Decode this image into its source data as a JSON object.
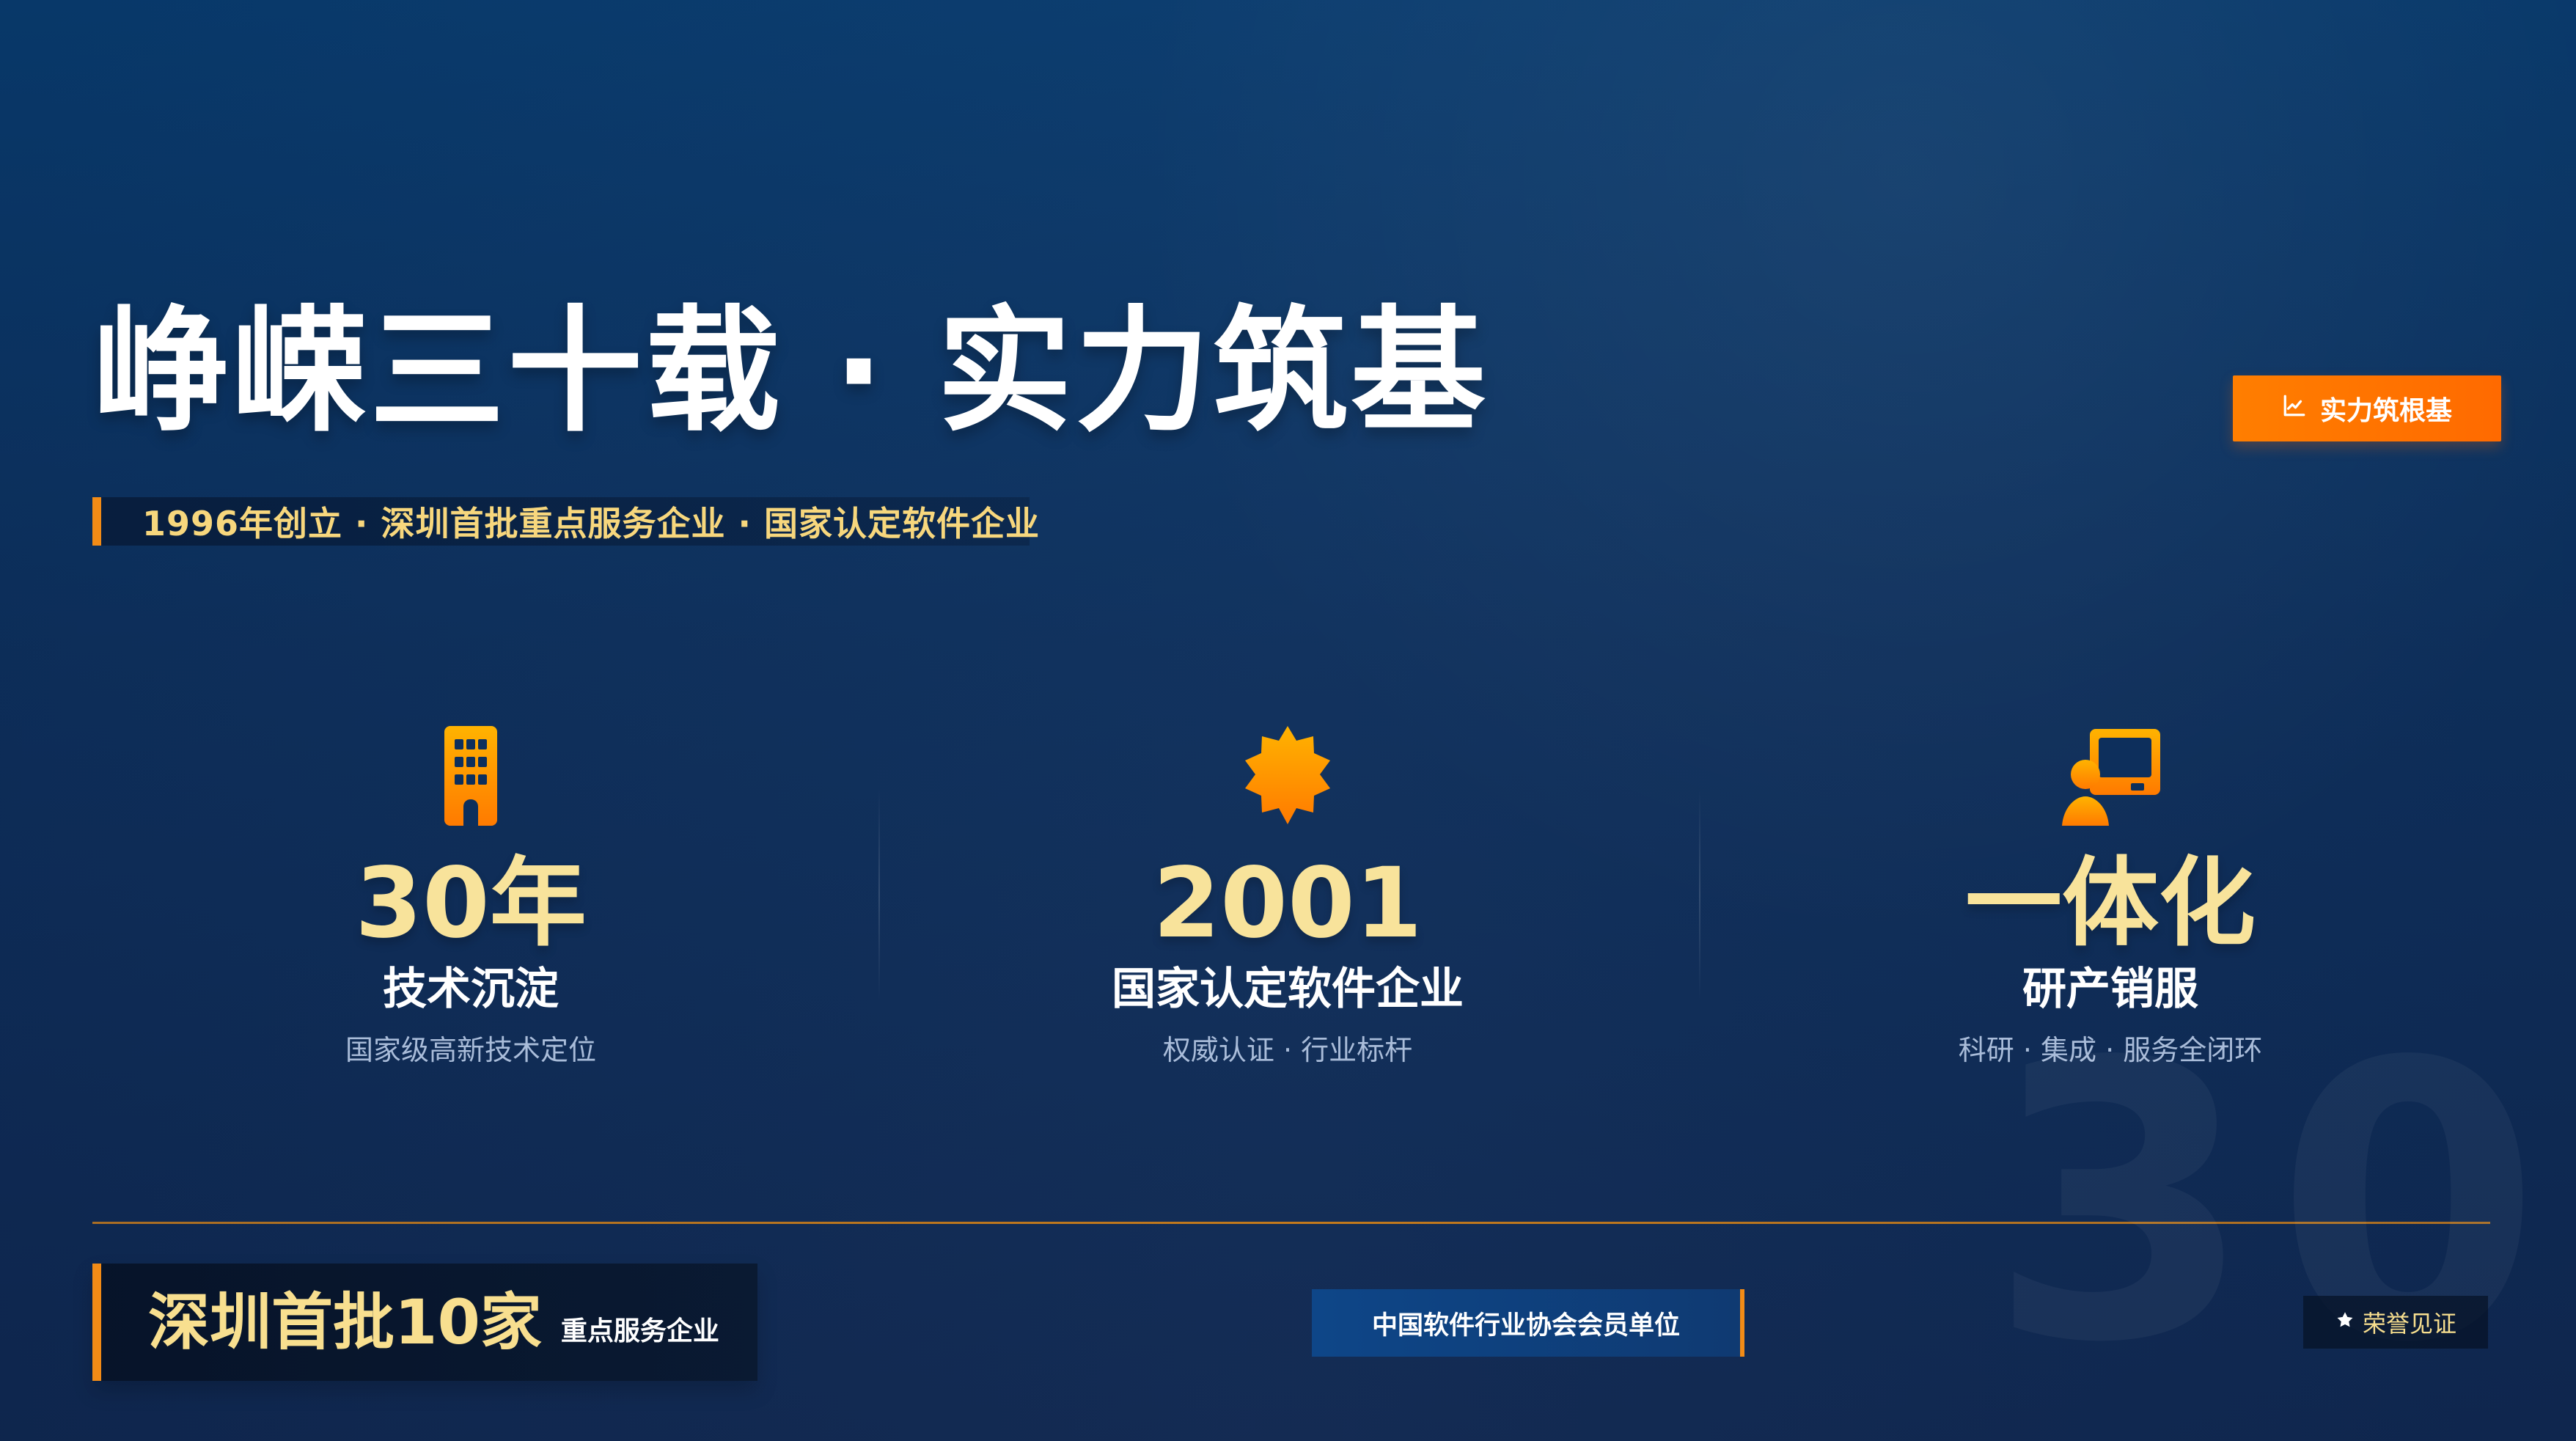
{
  "title": "峥嵘三十载 · 实力筑基",
  "subtitle": "1996年创立 · 深圳首批重点服务企业 · 国家认定软件企业",
  "top_badge": {
    "label": "实力筑根基",
    "icon": "chart-line-icon",
    "color": "#ff7200"
  },
  "stats": [
    {
      "icon": "building-icon",
      "value": "30年",
      "label": "技术沉淀",
      "desc": "国家级高新技术定位"
    },
    {
      "icon": "badge-star-icon",
      "value": "2001",
      "label": "国家认定软件企业",
      "desc": "权威认证 · 行业标杆"
    },
    {
      "icon": "presenter-icon",
      "value": "一体化",
      "label": "研产销服",
      "desc": "科研 · 集成 · 服务全闭环"
    }
  ],
  "bottom": {
    "left_main": "深圳首批10家",
    "left_sub": "重点服务企业",
    "member": "中国软件行业协会会员单位",
    "honor": {
      "label": "荣誉见证",
      "icon": "star-icon"
    },
    "watermark": "30"
  },
  "colors": {
    "background_top": "#083a6d",
    "background_bottom": "#0f2750",
    "accent_orange": "#f28b16",
    "highlight_yellow": "#f8e39b",
    "muted_blue_text": "#a9bcd9"
  }
}
